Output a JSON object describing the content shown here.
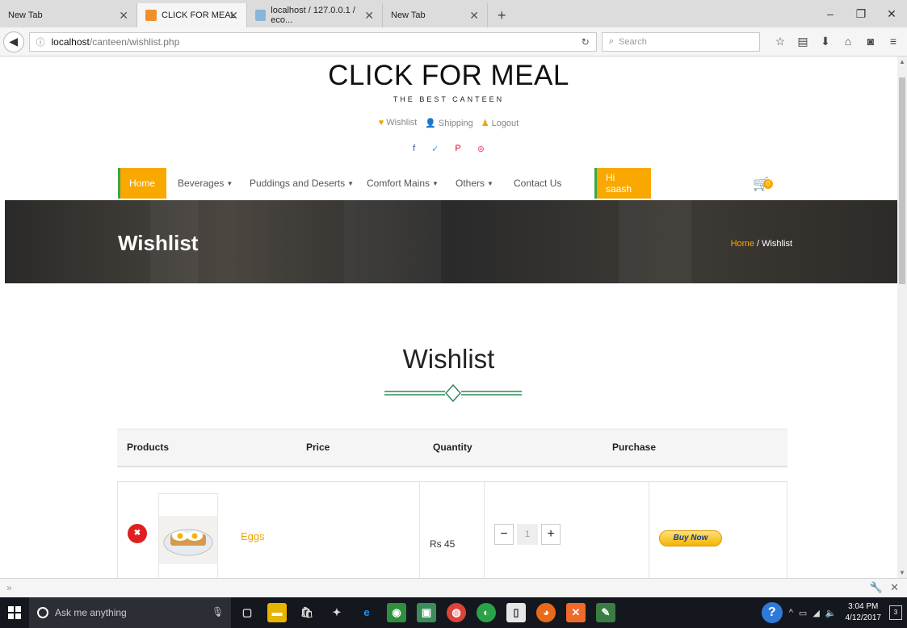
{
  "browser": {
    "tabs": [
      {
        "title": "New Tab",
        "active": false
      },
      {
        "title": "CLICK FOR MEAL",
        "active": true
      },
      {
        "title": "localhost / 127.0.0.1 / eco...",
        "active": false
      },
      {
        "title": "New Tab",
        "active": false
      }
    ],
    "url_host": "localhost",
    "url_path": "/canteen/wishlist.php",
    "search_placeholder": "Search",
    "toolbar_icons": [
      "star-icon",
      "reading-list-icon",
      "download-icon",
      "home-icon",
      "pocket-icon",
      "menu-icon"
    ]
  },
  "site": {
    "brand": "CLICK FOR MEAL",
    "tagline": "THE BEST CANTEEN",
    "top_links": [
      {
        "label": "Wishlist",
        "icon": "heart-icon"
      },
      {
        "label": "Shipping",
        "icon": "user-icon"
      },
      {
        "label": "Logout",
        "icon": "user-icon"
      }
    ],
    "social": [
      "f",
      "✓",
      "P",
      "⊛"
    ],
    "nav": {
      "home": "Home",
      "beverages": "Beverages",
      "puddings": "Puddings and Deserts",
      "comfort": "Comfort Mains",
      "others": "Others",
      "contact": "Contact Us",
      "greeting": "Hi saash",
      "cart_count": "0"
    },
    "banner": {
      "title": "Wishlist",
      "crumb_home": "Home",
      "crumb_sep": " / ",
      "crumb_current": "Wishlist"
    },
    "section_title": "Wishlist",
    "table": {
      "headers": [
        "Products",
        "Price",
        "Quantity",
        "Purchase"
      ],
      "rows": [
        {
          "name": "Eggs",
          "price": "Rs 45",
          "quantity": "1",
          "buy_label": "Buy Now"
        }
      ]
    }
  },
  "taskbar": {
    "search_placeholder": "Ask me anything",
    "time": "3:04 PM",
    "date": "4/12/2017",
    "notifications": "3"
  },
  "colors": {
    "accent": "#f9a800",
    "green": "#3aa64a",
    "remove": "#e02020"
  }
}
